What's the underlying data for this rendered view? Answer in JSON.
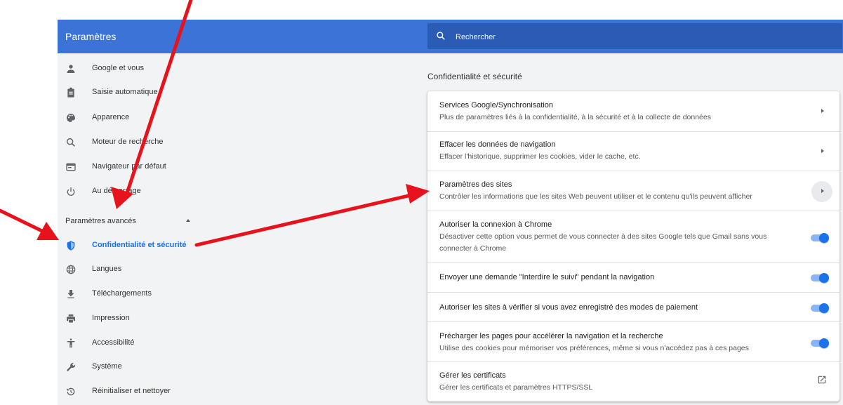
{
  "header": {
    "title": "Paramètres"
  },
  "search": {
    "placeholder": "Rechercher",
    "value": ""
  },
  "sidebar": {
    "items": [
      {
        "label": "Google et vous",
        "icon": "person-icon"
      },
      {
        "label": "Saisie automatique",
        "icon": "clipboard-icon"
      },
      {
        "label": "Apparence",
        "icon": "palette-icon"
      },
      {
        "label": "Moteur de recherche",
        "icon": "search-icon"
      },
      {
        "label": "Navigateur par défaut",
        "icon": "browser-icon"
      },
      {
        "label": "Au démarrage",
        "icon": "power-icon"
      }
    ],
    "advanced_label": "Paramètres avancés",
    "advanced_items": [
      {
        "label": "Confidentialité et sécurité",
        "icon": "shield-icon",
        "active": true
      },
      {
        "label": "Langues",
        "icon": "globe-icon"
      },
      {
        "label": "Téléchargements",
        "icon": "download-icon"
      },
      {
        "label": "Impression",
        "icon": "printer-icon"
      },
      {
        "label": "Accessibilité",
        "icon": "accessibility-icon"
      },
      {
        "label": "Système",
        "icon": "wrench-icon"
      },
      {
        "label": "Réinitialiser et nettoyer",
        "icon": "restore-icon"
      }
    ]
  },
  "main": {
    "section_title": "Confidentialité et sécurité",
    "rows": [
      {
        "title": "Services Google/Synchronisation",
        "subtitle": "Plus de paramètres liés à la confidentialité, à la sécurité et à la collecte de données",
        "control": "chevron"
      },
      {
        "title": "Effacer les données de navigation",
        "subtitle": "Effacer l'historique, supprimer les cookies, vider le cache, etc.",
        "control": "chevron"
      },
      {
        "title": "Paramètres des sites",
        "subtitle": "Contrôler les informations que les sites Web peuvent utiliser et le contenu qu'ils peuvent afficher",
        "control": "chevron-hover"
      },
      {
        "title": "Autoriser la connexion à Chrome",
        "subtitle": "Désactiver cette option vous permet de vous connecter à des sites Google tels que Gmail sans vous connecter à Chrome",
        "control": "toggle",
        "checked": true
      },
      {
        "title": "Envoyer une demande \"Interdire le suivi\" pendant la navigation",
        "subtitle": "",
        "control": "toggle",
        "checked": true
      },
      {
        "title": "Autoriser les sites à vérifier si vous avez enregistré des modes de paiement",
        "subtitle": "",
        "control": "toggle",
        "checked": true
      },
      {
        "title": "Précharger les pages pour accélérer la navigation et la recherche",
        "subtitle": "Utilise des cookies pour mémoriser vos préférences, même si vous n'accédez pas à ces pages",
        "control": "toggle",
        "checked": true
      },
      {
        "title": "Gérer les certificats",
        "subtitle": "Gérer les certificats et paramètres HTTPS/SSL",
        "control": "external-link"
      }
    ]
  },
  "colors": {
    "header": "#3b73d6",
    "search_bg": "#2a5bb5",
    "accent": "#1a73e8",
    "annotation_arrow": "#e8121c"
  }
}
